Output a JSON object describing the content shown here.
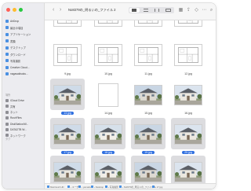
{
  "window": {
    "title": "No8379の_明るいの_ファイル 2"
  },
  "sidebar": {
    "favorites": [
      {
        "label": "AirDrop",
        "icon": "airdrop-icon"
      },
      {
        "label": "最近の項目",
        "icon": "clock-icon"
      },
      {
        "label": "アプリケーション",
        "icon": "applications-icon"
      },
      {
        "label": "書類",
        "icon": "document-icon"
      },
      {
        "label": "デスクトップ",
        "icon": "desktop-icon"
      },
      {
        "label": "ダウンロード",
        "icon": "download-icon"
      },
      {
        "label": "写真撮影",
        "icon": "folder-icon"
      },
      {
        "label": "Creative Cloud...",
        "icon": "cloud-icon"
      },
      {
        "label": "nagasakisoku...",
        "icon": "folder-icon"
      }
    ],
    "locations_header": "場所",
    "locations": [
      {
        "label": "iCloud Drive",
        "icon": "cloud-icon"
      },
      {
        "label": "共有",
        "icon": "shared-icon"
      },
      {
        "label": "ネット",
        "icon": "network-icon"
      },
      {
        "label": "RushFiles",
        "icon": "drive-icon"
      },
      {
        "label": "DiskStation/W...",
        "icon": "server-icon"
      },
      {
        "label": "DATA2TB W...",
        "icon": "disk-icon"
      },
      {
        "label": "ネットワーク",
        "icon": "globe-icon"
      }
    ],
    "tags_header": "タグ"
  },
  "files": [
    {
      "name": "",
      "thumb": "floorplan",
      "selected": false
    },
    {
      "name": "",
      "thumb": "floorplan",
      "selected": false
    },
    {
      "name": "",
      "thumb": "floorplan",
      "selected": false
    },
    {
      "name": "",
      "thumb": "floorplan",
      "selected": false
    },
    {
      "name": "9.jpg",
      "thumb": "floorplan",
      "selected": false
    },
    {
      "name": "10.jpg",
      "thumb": "floorplan",
      "selected": false
    },
    {
      "name": "11.jpg",
      "thumb": "floorplan",
      "selected": false
    },
    {
      "name": "12.jpg",
      "thumb": "floorplan",
      "selected": false
    },
    {
      "name": "13.jpg",
      "thumb": "house",
      "selected": true
    },
    {
      "name": "14.jpg",
      "thumb": "blank",
      "selected": false
    },
    {
      "name": "15.jpg",
      "thumb": "house",
      "selected": false
    },
    {
      "name": "16.jpg",
      "thumb": "house",
      "selected": false
    },
    {
      "name": "17.jpg",
      "thumb": "house",
      "selected": true
    },
    {
      "name": "18.jpg",
      "thumb": "house",
      "selected": true
    },
    {
      "name": "19.jpg",
      "thumb": "house",
      "selected": true
    },
    {
      "name": "20.jpg",
      "thumb": "house",
      "selected": true
    },
    {
      "name": "21.jpg",
      "thumb": "house",
      "selected": true
    },
    {
      "name": "22.jpg",
      "thumb": "house",
      "selected": true
    },
    {
      "name": "23.jpg",
      "thumb": "house",
      "selected": true
    },
    {
      "name": "24.jpg",
      "thumb": "house",
      "selected": true
    }
  ],
  "pathbar": [
    "Macintosh HD",
    "ユーザ",
    "yamada",
    "Desktop",
    "写真撮影",
    "No8379の_明るいの_ファイル 2",
    "17.jpg"
  ],
  "colors": {
    "accent": "#2f6fe0",
    "close": "#ff5f57",
    "minimize": "#febc2e",
    "zoom": "#28c840"
  }
}
